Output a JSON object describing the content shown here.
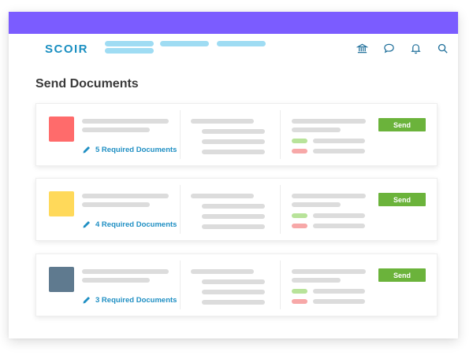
{
  "app": {
    "logo": "SCOIR"
  },
  "colors": {
    "topbar": "#7b5cff",
    "accent": "#1f8fc3",
    "send": "#6bb33b"
  },
  "nav": {
    "icons": [
      "bank-icon",
      "chat-icon",
      "bell-icon",
      "search-icon"
    ]
  },
  "page": {
    "title": "Send Documents"
  },
  "cards": [
    {
      "swatch_color": "#ff6b6b",
      "required_label": "5 Required Documents",
      "send_label": "Send"
    },
    {
      "swatch_color": "#ffd95a",
      "required_label": "4 Required Documents",
      "send_label": "Send"
    },
    {
      "swatch_color": "#5f7a8f",
      "required_label": "3 Required Documents",
      "send_label": "Send"
    }
  ]
}
